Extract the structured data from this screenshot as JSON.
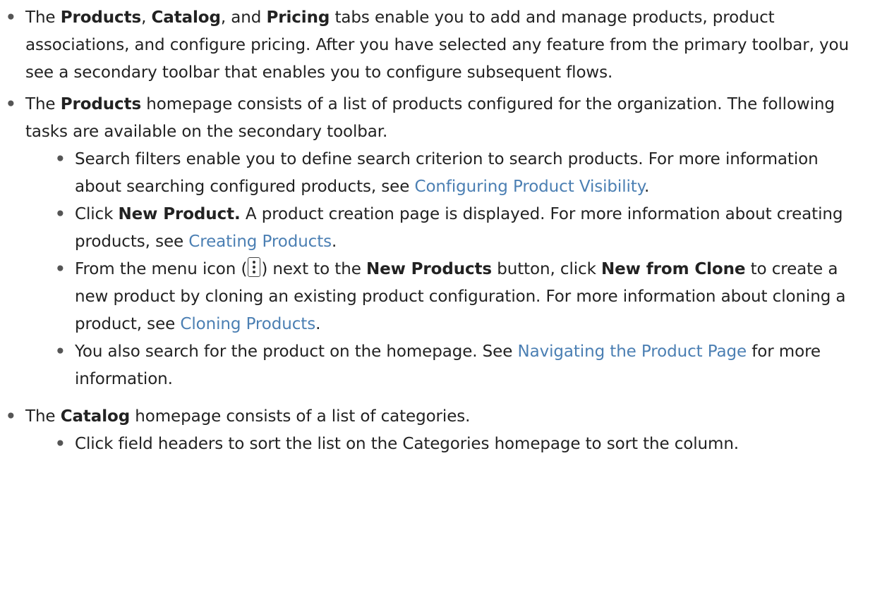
{
  "bullet_symbol": "•",
  "items": [
    {
      "t0": "The ",
      "b1": "Products",
      "t2": ", ",
      "b3": "Catalog",
      "t4": ", and ",
      "b5": "Pricing",
      "t6": " tabs enable you to add and manage products, product associations, and configure pricing. After you have selected any feature from the primary toolbar, you see a secondary toolbar that enables you to configure subsequent flows."
    },
    {
      "t0": "The ",
      "b1": "Products",
      "t2": " homepage consists of a list of products configured for the organization. The following tasks are available on the secondary toolbar.",
      "sub": [
        {
          "t0": "Search filters enable you to define search criterion to search products. For more information about searching configured products, see ",
          "link": "Configuring Product Visibility",
          "t1": "."
        },
        {
          "t0": "Click ",
          "b1": "New Product.",
          "t2": " A product creation page is displayed. For more information about creating products, see ",
          "link": "Creating Products",
          "t3": "."
        },
        {
          "t0": "From the menu icon (",
          "icon": "vertical-ellipsis-menu-icon",
          "t1": ") next to the ",
          "b2": "New Products",
          "t3": " button, click ",
          "b4": "New from Clone",
          "t5": " to create a new product by cloning an existing product configuration. For more information about cloning a product, see ",
          "link": "Cloning Products",
          "t6": "."
        },
        {
          "t0": "You also search for the product on the homepage. See ",
          "link": "Navigating the Product Page",
          "t1": " for more information."
        }
      ]
    },
    {
      "t0": "The ",
      "b1": "Catalog",
      "t2": " homepage consists of a list of categories.",
      "sub": [
        {
          "t0": "Click field headers to sort the list on the Categories homepage to sort the column."
        }
      ]
    }
  ],
  "colors": {
    "text": "#222222",
    "link": "#4b7fb3",
    "bullet": "#555555"
  }
}
